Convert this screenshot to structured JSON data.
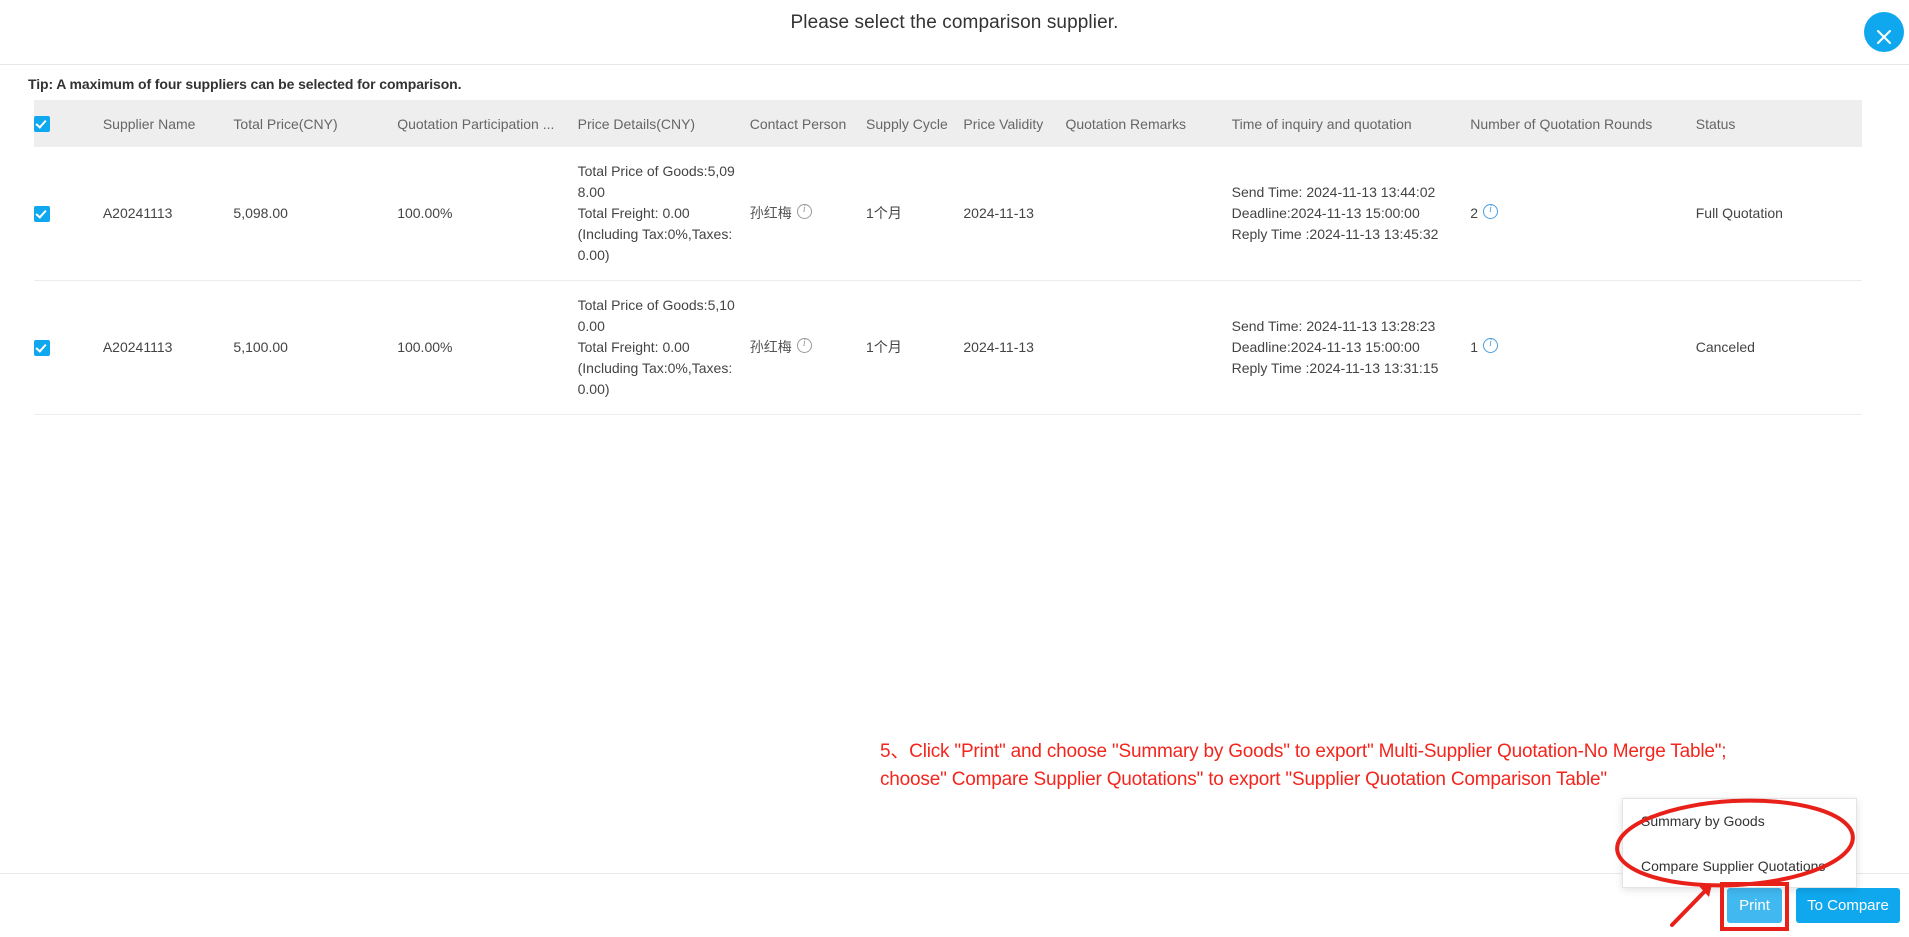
{
  "dialog": {
    "title": "Please select the comparison supplier.",
    "close_icon": "close-icon",
    "tip": "Tip: A maximum of four suppliers can be selected for comparison."
  },
  "table": {
    "header_select_all_checked": true,
    "columns": [
      "Supplier Name",
      "Total Price(CNY)",
      "Quotation Participation ...",
      "Price Details(CNY)",
      "Contact Person",
      "Supply Cycle",
      "Price Validity",
      "Quotation Remarks",
      "Time of inquiry and quotation",
      "Number of Quotation Rounds",
      "Status"
    ],
    "rows": [
      {
        "selected": true,
        "supplier_name": "A20241113",
        "total_price": "5,098.00",
        "participation": "100.00%",
        "price_details": [
          "Total Price of Goods:5,09",
          "8.00",
          "Total Freight: 0.00",
          "(Including Tax:0%,Taxes:",
          "0.00)"
        ],
        "contact_person": "孙红梅",
        "supply_cycle": "1个月",
        "price_validity": "2024-11-13",
        "quotation_remarks": "",
        "time_lines": [
          "Send Time: 2024-11-13 13:44:02",
          "Deadline:2024-11-13 15:00:00",
          "Reply Time :2024-11-13 13:45:32"
        ],
        "rounds": "2",
        "status": "Full Quotation"
      },
      {
        "selected": true,
        "supplier_name": "A20241113",
        "total_price": "5,100.00",
        "participation": "100.00%",
        "price_details": [
          "Total Price of Goods:5,10",
          "0.00",
          "Total Freight: 0.00",
          "(Including Tax:0%,Taxes:",
          "0.00)"
        ],
        "contact_person": "孙红梅",
        "supply_cycle": "1个月",
        "price_validity": "2024-11-13",
        "quotation_remarks": "",
        "time_lines": [
          "Send Time: 2024-11-13 13:28:23",
          "Deadline:2024-11-13 15:00:00",
          "Reply Time :2024-11-13 13:31:15"
        ],
        "rounds": "1",
        "status": "Canceled"
      }
    ]
  },
  "dropdown": {
    "items": [
      "Summary by Goods",
      "Compare Supplier Quotations"
    ]
  },
  "footer": {
    "print_label": "Print",
    "compare_label": "To Compare"
  },
  "annotation": {
    "line1": "5、Click \"Print\" and choose \"Summary by Goods\" to export\" Multi-Supplier Quotation-No Merge Table\";",
    "line2": "choose\" Compare Supplier Quotations\" to export \"Supplier Quotation Comparison Table\"",
    "color": "#f3261e"
  },
  "colors": {
    "accent": "#0fa8ee",
    "print_button": "#41b8f0",
    "header_bg": "#eeeeee",
    "annotation_red": "#f3261e"
  }
}
